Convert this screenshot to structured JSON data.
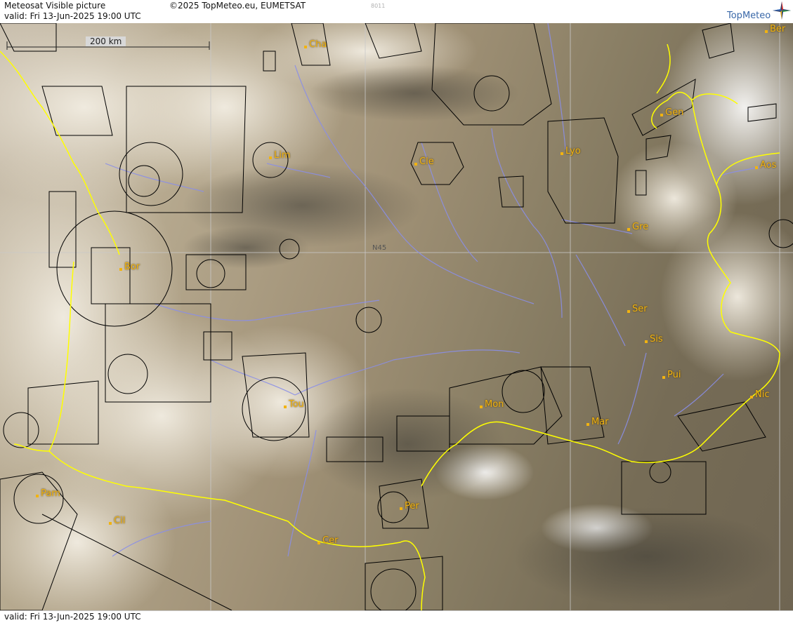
{
  "header": {
    "title": "Meteosat Visible picture",
    "copyright": "©2025 TopMeteo.eu, EUMETSAT",
    "image_code": "8011",
    "valid": "valid:  Fri  13-Jun-2025  19:00 UTC",
    "brand": "TopMeteo",
    "brand_icon": "compass-star-icon"
  },
  "map": {
    "scale_bar_label": "200 km",
    "grid_label": "N45",
    "cities": [
      {
        "label": "Cha"
      },
      {
        "label": "Ber"
      },
      {
        "label": "Gen"
      },
      {
        "label": "Lim"
      },
      {
        "label": "Cle"
      },
      {
        "label": "Lyo"
      },
      {
        "label": "Aos"
      },
      {
        "label": "Gre"
      },
      {
        "label": "Bor"
      },
      {
        "label": "Ser"
      },
      {
        "label": "Sis"
      },
      {
        "label": "Pui"
      },
      {
        "label": "Tou"
      },
      {
        "label": "Mon"
      },
      {
        "label": "Mar"
      },
      {
        "label": "Nic"
      },
      {
        "label": "Pam"
      },
      {
        "label": "Per"
      },
      {
        "label": "Cil"
      },
      {
        "label": "Cer"
      }
    ],
    "colors": {
      "border": "#ffff00",
      "rivers": "#8a8ee8",
      "airspace": "#000000",
      "city_label": "#f2b310",
      "grid": "#c8c8c8"
    }
  },
  "footer": {
    "valid": "valid:  Fri  13-Jun-2025  19:00 UTC"
  }
}
